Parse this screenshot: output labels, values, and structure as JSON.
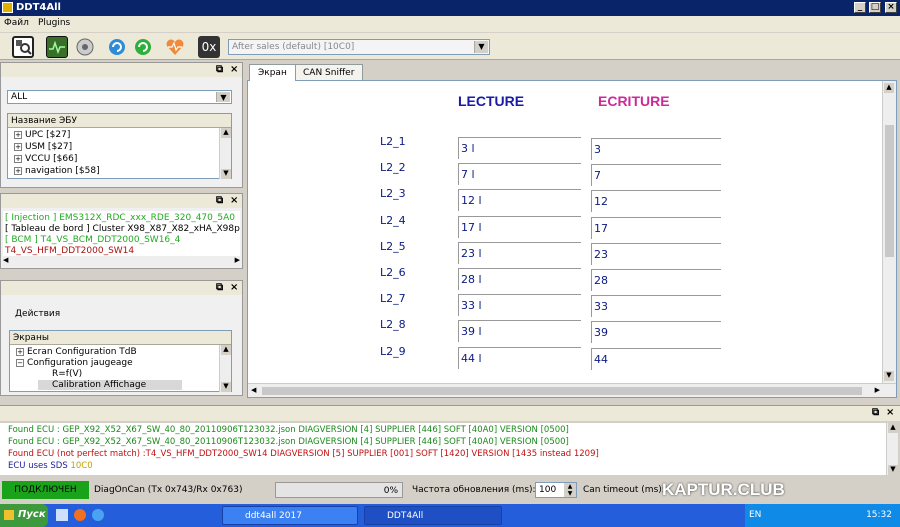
{
  "window": {
    "title": "DDT4All"
  },
  "menu": {
    "file": "Файл",
    "plugins": "Plugins"
  },
  "toolbar": {
    "ecu_combo_value": "After sales (default) [10C0]",
    "hex_label": "0x"
  },
  "left": {
    "filter_value": "ALL",
    "ecu_header": "Название ЭБУ",
    "ecu_list": [
      "UPC [$27]",
      "USM [$27]",
      "VCCU [$66]",
      "navigation [$58]"
    ],
    "db_items": [
      {
        "text": "[ Injection ] EMS312X_RDC_xxx_RDE_320_470_5A0",
        "color": "#22aa22"
      },
      {
        "text": "[ Tableau de bord ] Cluster X98_X87_X82_xHA_X98p",
        "color": "#000000"
      },
      {
        "text": "[ BCM ] T4_VS_BCM_DDT2000_SW16_4",
        "color": "#22aa22"
      },
      {
        "text": "T4_VS_HFM_DDT2000_SW14",
        "color": "#aa1111"
      }
    ],
    "actions_label": "Действия",
    "screens_header": "Экраны",
    "screens": [
      "Ecran Configuration TdB",
      "Configuration jaugeage",
      "R=f(V)",
      "Calibration Affichage"
    ]
  },
  "tabs": [
    "Экран",
    "CAN Sniffer"
  ],
  "screen": {
    "read_header": "LECTURE",
    "write_header": "ECRITURE",
    "read_color": "#1a1aa6",
    "write_color": "#cc2a9a",
    "rows": [
      {
        "label": "L2_1",
        "read": "3 l",
        "write": "3"
      },
      {
        "label": "L2_2",
        "read": "7 l",
        "write": "7"
      },
      {
        "label": "L2_3",
        "read": "12 l",
        "write": "12"
      },
      {
        "label": "L2_4",
        "read": "17 l",
        "write": "17"
      },
      {
        "label": "L2_5",
        "read": "23 l",
        "write": "23"
      },
      {
        "label": "L2_6",
        "read": "28 l",
        "write": "28"
      },
      {
        "label": "L2_7",
        "read": "33 l",
        "write": "33"
      },
      {
        "label": "L2_8",
        "read": "39 l",
        "write": "39"
      },
      {
        "label": "L2_9",
        "read": "44 l",
        "write": "44"
      }
    ]
  },
  "log": [
    {
      "parts": [
        {
          "t": "Found ECU : GEP_X92_X52_X67_SW_40_80_20110906T123032.json DIAGVERSION [4] SUPPLIER [446] SOFT [40A0] VERSION [0500]",
          "c": "#1a8a1a"
        }
      ]
    },
    {
      "parts": [
        {
          "t": "Found ECU : GEP_X92_X52_X67_SW_40_80_20110906T123032.json DIAGVERSION [4] SUPPLIER [446] SOFT [40A0] VERSION [0500]",
          "c": "#1a8a1a"
        }
      ]
    },
    {
      "parts": [
        {
          "t": "Found ECU (not perfect match) :T4_VS_HFM_DDT2000_SW14 DIAGVERSION [5] SUPPLIER [001] SOFT [1420] VERSION [1435 instead 1209]",
          "c": "#c01010"
        }
      ]
    },
    {
      "parts": [
        {
          "t": "ECU uses SDS ",
          "c": "#1a1aa6"
        },
        {
          "t": "10C0",
          "c": "#c0a000"
        }
      ]
    }
  ],
  "status": {
    "connected": "ПОДКЛЮЧЕН",
    "protocol": "DiagOnCan (Tx 0x743/Rx 0x763)",
    "progress_text": "0%",
    "progress": 0,
    "refresh_label": "Частота обновления (ms):",
    "refresh_value": "100",
    "can_timeout_label": "Can timeout (ms):",
    "watermark": "KAPTUR.CLUB"
  },
  "taskbar": {
    "start": "Пуск",
    "tasks": [
      "ddt4all 2017",
      "DDT4All"
    ],
    "lang": "EN",
    "clock": "15:32"
  }
}
